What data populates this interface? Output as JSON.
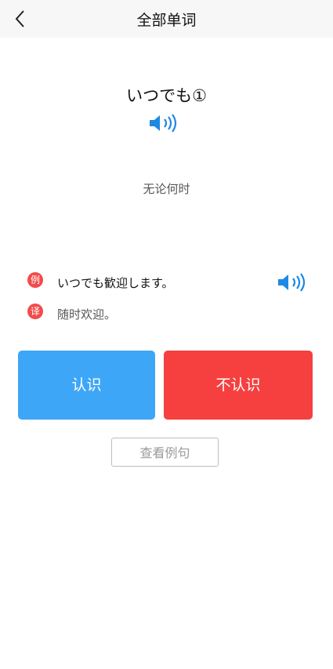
{
  "header": {
    "title": "全部单词",
    "back_icon": "chevron-left-icon"
  },
  "word_card": {
    "word": "いつでも①",
    "speaker_icon": "speaker-icon",
    "meaning": "无论何时"
  },
  "example": {
    "example_badge": "例",
    "example_sentence": "いつでも歓迎します。",
    "translation_badge": "译",
    "translation": "随时欢迎。",
    "speaker_icon": "speaker-icon"
  },
  "actions": {
    "know_label": "认识",
    "unknown_label": "不认识",
    "view_examples_label": "查看例句"
  },
  "colors": {
    "accent_blue": "#3ea6f6",
    "accent_red": "#f5403f",
    "badge_red": "#f24b4b",
    "speaker_blue": "#1e88e5"
  }
}
